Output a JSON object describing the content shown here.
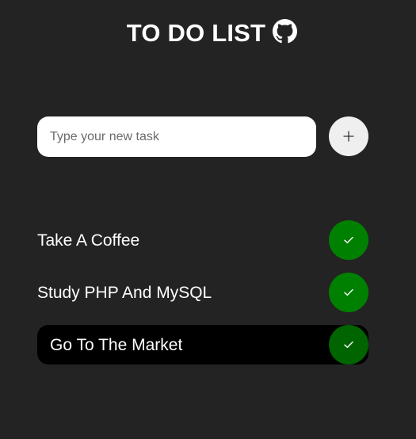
{
  "header": {
    "title": "TO DO LIST",
    "icon": "github-icon"
  },
  "new_task": {
    "value": "",
    "placeholder": "Type your new task",
    "add_icon": "plus-icon"
  },
  "tasks": [
    {
      "label": "Take A Coffee",
      "status_icon": "check-icon",
      "highlighted": false
    },
    {
      "label": "Study PHP And MySQL",
      "status_icon": "check-icon",
      "highlighted": false
    },
    {
      "label": "Go To The Market",
      "status_icon": "check-icon",
      "highlighted": true
    }
  ],
  "colors": {
    "background": "#232323",
    "input_background": "#ffffff",
    "add_button": "#efefef",
    "check_button": "#008000",
    "check_button_active": "#006400",
    "highlighted_row": "#000000",
    "text": "#ffffff"
  }
}
